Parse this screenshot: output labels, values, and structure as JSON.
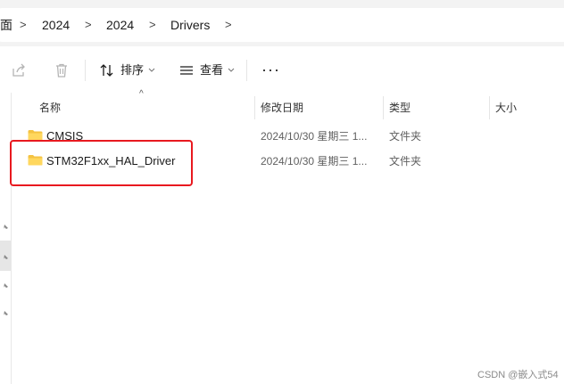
{
  "address_bar": {
    "crumbs": [
      "面",
      "2024",
      "2024",
      "Drivers"
    ],
    "chevron": ">"
  },
  "toolbar": {
    "share_icon": "share-icon",
    "delete_icon": "trash-icon",
    "sort_label": "排序",
    "view_label": "查看",
    "more_label": "···"
  },
  "columns": {
    "name": "名称",
    "modified": "修改日期",
    "type": "类型",
    "size": "大小",
    "sort_indicator": "^"
  },
  "files": [
    {
      "name": "CMSIS",
      "modified": "2024/10/30 星期三 1...",
      "type": "文件夹",
      "icon": "folder-icon"
    },
    {
      "name": "STM32F1xx_HAL_Driver",
      "modified": "2024/10/30 星期三 1...",
      "type": "文件夹",
      "icon": "folder-icon"
    }
  ],
  "watermark": "CSDN @嵌入式54",
  "colors": {
    "accent_red": "#e8191f",
    "folder_yellow": "#f4c342"
  }
}
